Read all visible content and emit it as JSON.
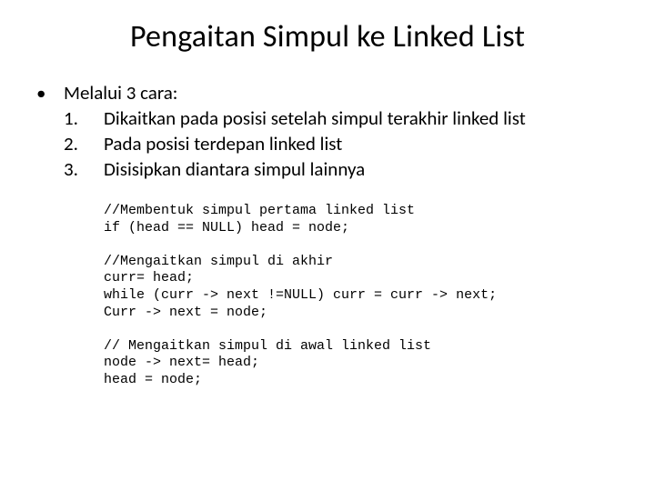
{
  "title": "Pengaitan Simpul ke Linked List",
  "bullet": "Melalui 3 cara:",
  "items": [
    {
      "num": "1.",
      "text": "Dikaitkan pada posisi setelah simpul terakhir linked list"
    },
    {
      "num": "2.",
      "text": "Pada posisi terdepan linked list"
    },
    {
      "num": "3.",
      "text": "Disisipkan diantara simpul lainnya"
    }
  ],
  "code": [
    "//Membentuk simpul pertama linked list\nif (head == NULL) head = node;",
    "//Mengaitkan simpul di akhir\ncurr= head;\nwhile (curr -> next !=NULL) curr = curr -> next;\nCurr -> next = node;",
    "// Mengaitkan simpul di awal linked list\nnode -> next= head;\nhead = node;"
  ]
}
